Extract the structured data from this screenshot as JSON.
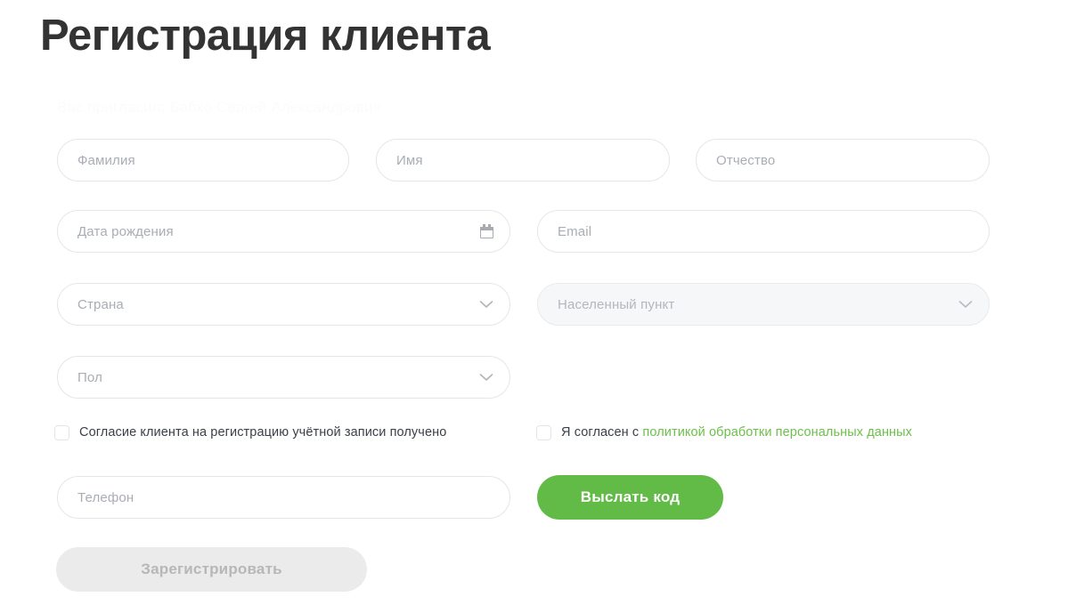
{
  "header": {
    "title": "Регистрация клиента",
    "subtitle": "Вас пригласил: Бабко Сергей Александрович"
  },
  "form": {
    "fields": [
      {
        "key": "lastname",
        "placeholder": "Фамилия",
        "type": "text",
        "disabled": false,
        "icon": ""
      },
      {
        "key": "firstname",
        "placeholder": "Имя",
        "type": "text",
        "disabled": false,
        "icon": ""
      },
      {
        "key": "middlename",
        "placeholder": "Отчество",
        "type": "text",
        "disabled": false,
        "icon": ""
      },
      {
        "key": "birthdate",
        "placeholder": "Дата рождения",
        "type": "date",
        "disabled": false,
        "icon": "calendar-icon"
      },
      {
        "key": "email",
        "placeholder": "Email",
        "type": "email",
        "disabled": false,
        "icon": ""
      },
      {
        "key": "country",
        "placeholder": "Страна",
        "type": "select",
        "disabled": false,
        "icon": "chevron-down-icon"
      },
      {
        "key": "locality",
        "placeholder": "Населенный пункт",
        "type": "select",
        "disabled": true,
        "icon": "chevron-down-icon"
      },
      {
        "key": "gender",
        "placeholder": "Пол",
        "type": "select",
        "disabled": false,
        "icon": "chevron-down-icon"
      },
      {
        "key": "phone",
        "placeholder": "Телефон",
        "type": "tel",
        "disabled": false,
        "icon": ""
      }
    ],
    "checkboxes": {
      "consent": {
        "label": "Согласие клиента на регистрацию учётной записи получено",
        "checked": false
      },
      "policy": {
        "prefix": "Я согласен с ",
        "link_text": "политикой обработки персональных данных",
        "checked": false
      }
    },
    "buttons": {
      "send_code": {
        "label": "Выслать код",
        "disabled": false
      },
      "register": {
        "label": "Зарегистрировать",
        "disabled": true
      }
    }
  },
  "colors": {
    "accent_green": "#62bb46",
    "link_green": "#6cbf4b",
    "title_dark": "#333333",
    "placeholder_gray": "#a9adb4",
    "border_gray": "#e4e6e8",
    "disabled_field_bg": "#f6f7f8",
    "disabled_button_bg": "#ebebeb",
    "disabled_button_text": "#b7b7b7",
    "subtitle_faint": "#fbfbfb"
  }
}
